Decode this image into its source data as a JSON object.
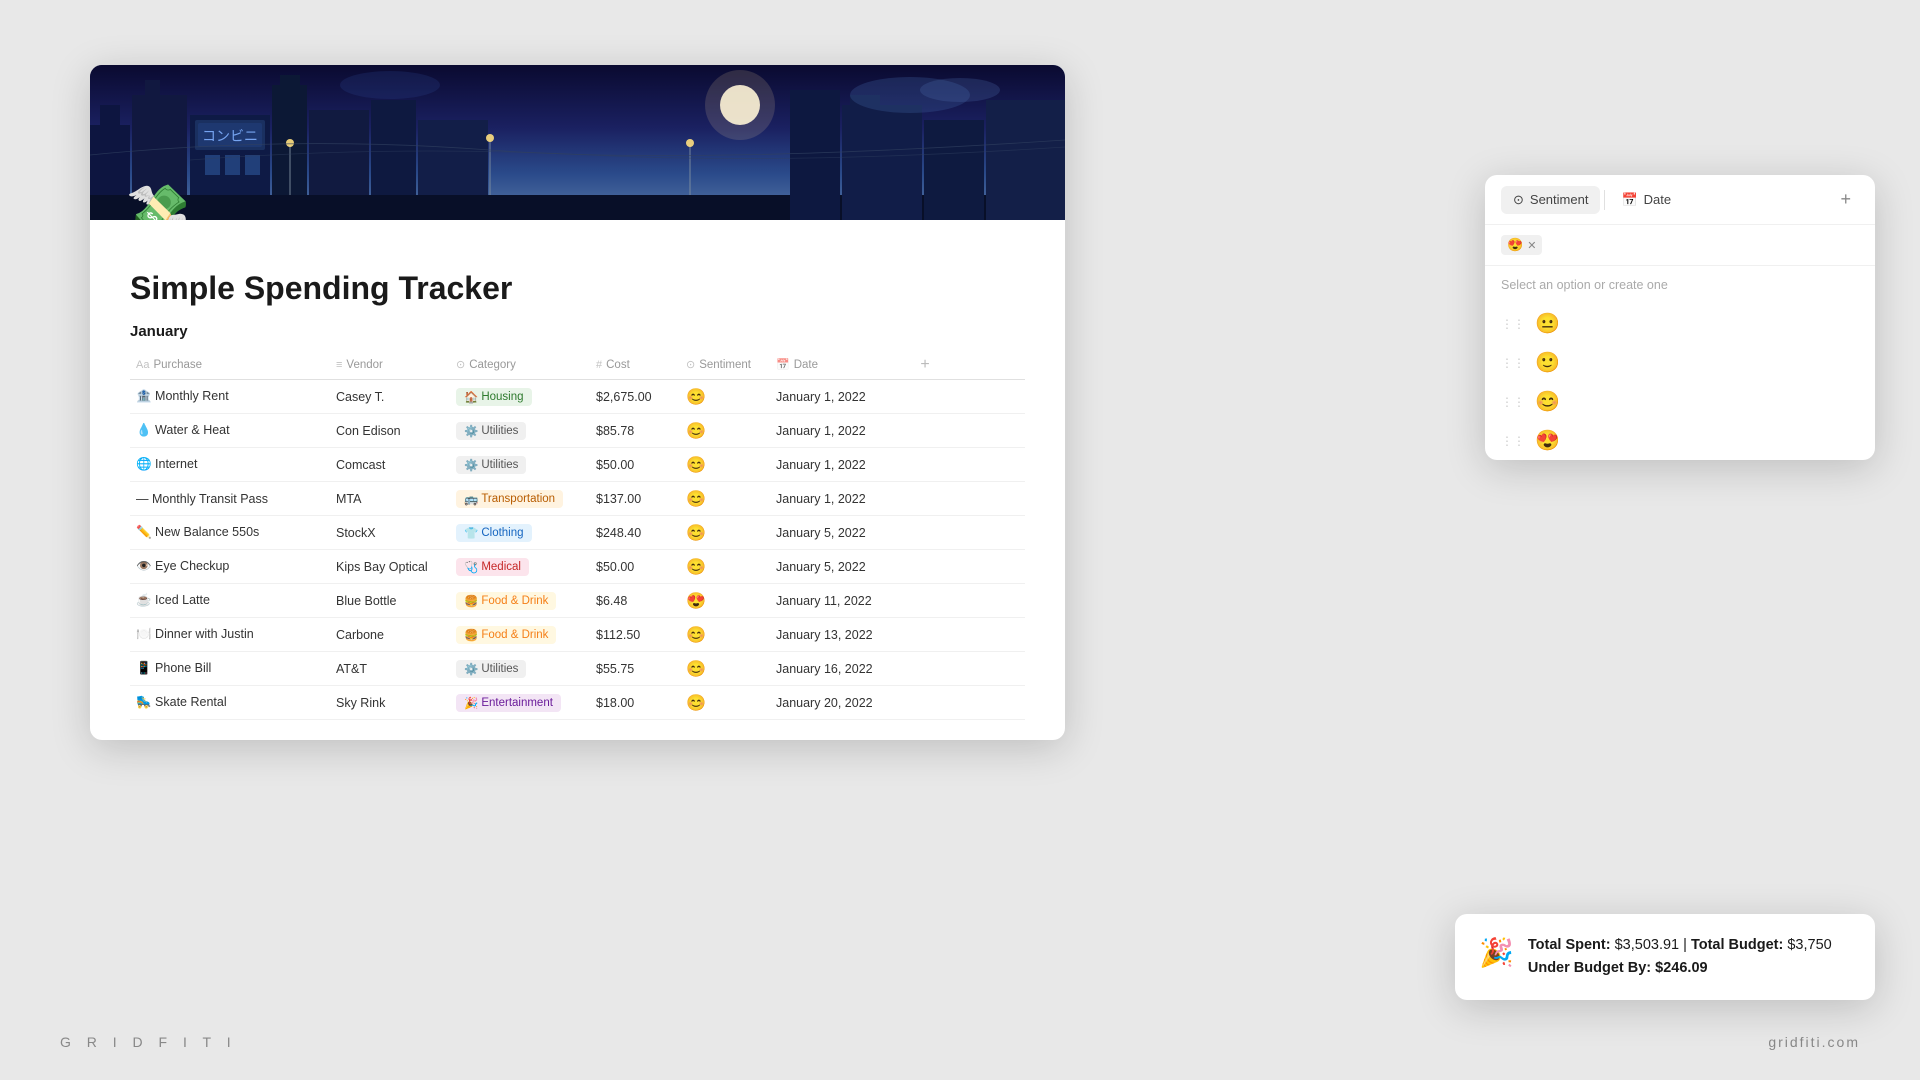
{
  "branding": {
    "left": "G R I D F I T I",
    "right": "gridfiti.com"
  },
  "page": {
    "title": "Simple Spending Tracker",
    "icon": "💸",
    "section": "January"
  },
  "table": {
    "columns": [
      {
        "label": "Purchase",
        "icon": "Aa"
      },
      {
        "label": "Vendor",
        "icon": "≡"
      },
      {
        "label": "Category",
        "icon": "⊙"
      },
      {
        "label": "Cost",
        "icon": "#"
      },
      {
        "label": "Sentiment",
        "icon": "⊙"
      },
      {
        "label": "Date",
        "icon": "📅"
      }
    ],
    "rows": [
      {
        "purchase": "🏦 Monthly Rent",
        "vendor": "Casey T.",
        "category": "Housing",
        "cat_class": "cat-housing",
        "cat_icon": "🏠",
        "cost": "$2,675.00",
        "sentiment": "😊",
        "date": "January 1, 2022"
      },
      {
        "purchase": "💧 Water & Heat",
        "vendor": "Con Edison",
        "category": "Utilities",
        "cat_class": "cat-utilities",
        "cat_icon": "⚙️",
        "cost": "$85.78",
        "sentiment": "😊",
        "date": "January 1, 2022"
      },
      {
        "purchase": "🌐 Internet",
        "vendor": "Comcast",
        "category": "Utilities",
        "cat_class": "cat-utilities",
        "cat_icon": "⚙️",
        "cost": "$50.00",
        "sentiment": "😊",
        "date": "January 1, 2022"
      },
      {
        "purchase": "— Monthly Transit Pass",
        "vendor": "MTA",
        "category": "Transportation",
        "cat_class": "cat-transportation",
        "cat_icon": "🚌",
        "cost": "$137.00",
        "sentiment": "😊",
        "date": "January 1, 2022"
      },
      {
        "purchase": "✏️ New Balance 550s",
        "vendor": "StockX",
        "category": "Clothing",
        "cat_class": "cat-clothing",
        "cat_icon": "👕",
        "cost": "$248.40",
        "sentiment": "😊",
        "date": "January 5, 2022"
      },
      {
        "purchase": "👁️ Eye Checkup",
        "vendor": "Kips Bay Optical",
        "category": "Medical",
        "cat_class": "cat-medical",
        "cat_icon": "🩺",
        "cost": "$50.00",
        "sentiment": "😊",
        "date": "January 5, 2022"
      },
      {
        "purchase": "☕ Iced Latte",
        "vendor": "Blue Bottle",
        "category": "Food & Drink",
        "cat_class": "cat-food",
        "cat_icon": "🍔",
        "cost": "$6.48",
        "sentiment": "😍",
        "date": "January 11, 2022"
      },
      {
        "purchase": "🍽️ Dinner with Justin",
        "vendor": "Carbone",
        "category": "Food & Drink",
        "cat_class": "cat-food",
        "cat_icon": "🍔",
        "cost": "$112.50",
        "sentiment": "😊",
        "date": "January 13, 2022"
      },
      {
        "purchase": "📱 Phone Bill",
        "vendor": "AT&T",
        "category": "Utilities",
        "cat_class": "cat-utilities",
        "cat_icon": "⚙️",
        "cost": "$55.75",
        "sentiment": "😊",
        "date": "January 16, 2022"
      },
      {
        "purchase": "🛼 Skate Rental",
        "vendor": "Sky Rink",
        "category": "Entertainment",
        "cat_class": "cat-entertainment",
        "cat_icon": "🎉",
        "cost": "$18.00",
        "sentiment": "😊",
        "date": "January 20, 2022"
      }
    ]
  },
  "dropdown": {
    "tabs": [
      {
        "label": "Sentiment",
        "icon": "⊙"
      },
      {
        "label": "Date",
        "icon": "📅"
      }
    ],
    "add_btn": "+",
    "selected_tag": "😍",
    "hint": "Select an option or create one",
    "options": [
      {
        "emoji": "😐"
      },
      {
        "emoji": "🙂"
      },
      {
        "emoji": "😊"
      },
      {
        "emoji": "😍"
      }
    ]
  },
  "budget": {
    "icon": "🎉",
    "total_spent_label": "Total Spent:",
    "total_spent_value": "$3,503.91",
    "separator": " | ",
    "total_budget_label": "Total Budget:",
    "total_budget_value": "$3,750",
    "under_budget_label": "Under Budget By:",
    "under_budget_value": "$246.09"
  }
}
